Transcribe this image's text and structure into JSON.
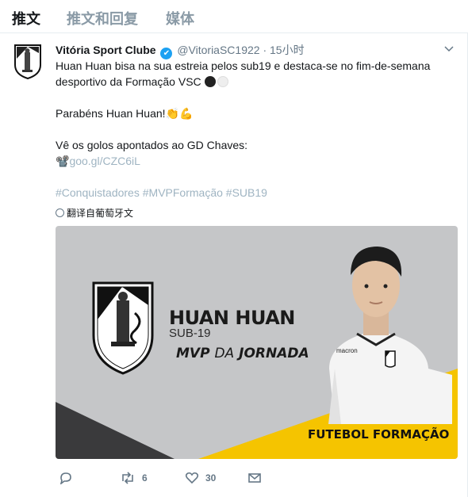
{
  "tabs": [
    {
      "label": "推文",
      "active": true
    },
    {
      "label": "推文和回复",
      "active": false
    },
    {
      "label": "媒体",
      "active": false
    }
  ],
  "tweet": {
    "author_name": "Vitória Sport Clube",
    "verified_mark": "✔",
    "handle": "@VitoriaSC1922",
    "separator": "·",
    "time": "15小时",
    "line1": "Huan Huan bisa na sua estreia pelos sub19 e destaca-se no fim-de-semana",
    "line2": "desportivo da Formação VSC",
    "line3": "Parabéns Huan Huan!👏💪",
    "line4": "Vê os golos apontados ao GD Chaves:",
    "link_emoji": "📽️",
    "link": "goo.gl/CZC6iL",
    "hashtags": [
      "#Conquistadores",
      "#MVPFormação",
      "#SUB19"
    ],
    "translate_label": "翻译自葡萄牙文"
  },
  "media": {
    "player_name": "HUAN HUAN",
    "sub_label": "SUB-19",
    "mvp": "MVP",
    "da": "DA",
    "jornada": "JORNADA",
    "banner": "FUTEBOL FORMAÇÃO",
    "jersey_brand": "macron",
    "colors": {
      "background": "#c5c6c8",
      "yellow": "#f5c400",
      "dark": "#3a3a3c"
    }
  },
  "actions": {
    "reply_count": "",
    "retweet_count": "6",
    "like_count": "30"
  },
  "colors": {
    "link": "#9fb4c2",
    "verified": "#1da1f2",
    "muted": "#657786"
  }
}
